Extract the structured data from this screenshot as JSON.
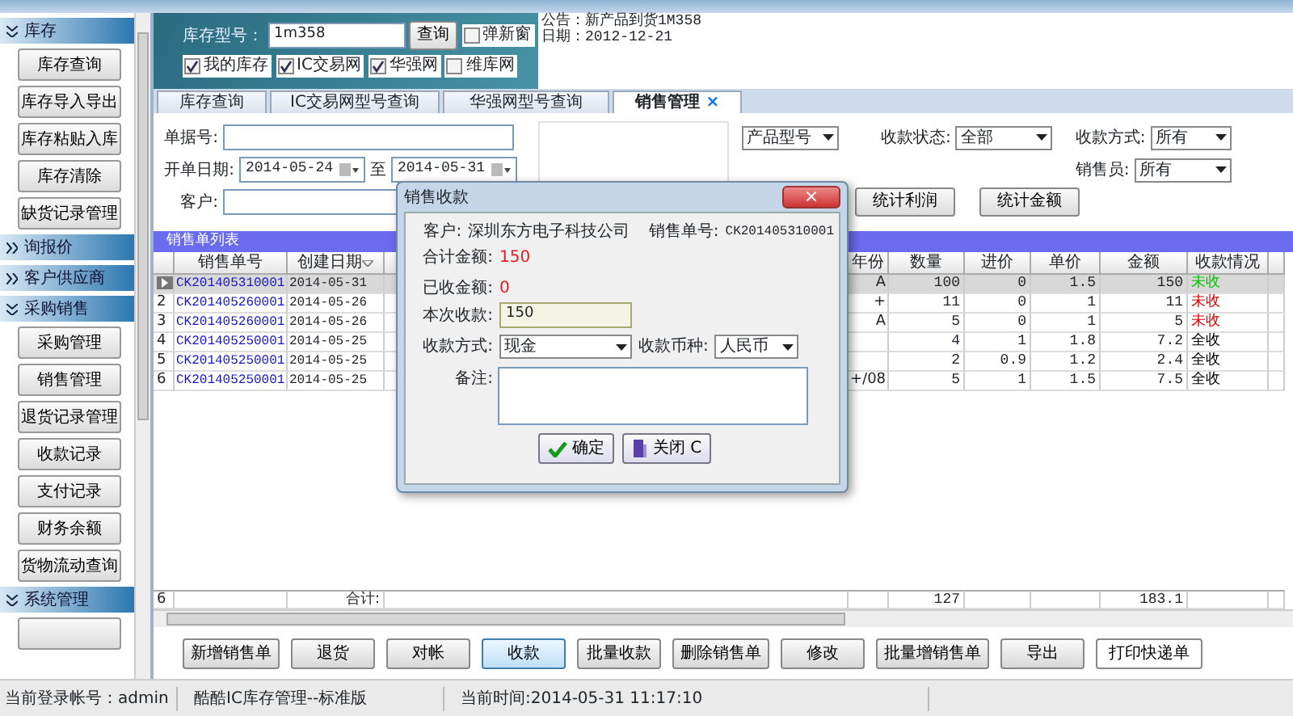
{
  "sidebar": {
    "sections": [
      {
        "label": "库存",
        "expanded": true,
        "items": [
          "库存查询",
          "库存导入导出",
          "库存粘贴入库",
          "库存清除",
          "缺货记录管理"
        ]
      },
      {
        "label": "询报价",
        "expanded": false
      },
      {
        "label": "客户供应商",
        "expanded": false
      },
      {
        "label": "采购销售",
        "expanded": true,
        "items": [
          "采购管理",
          "销售管理",
          "退货记录管理",
          "收款记录",
          "支付记录",
          "财务余额",
          "货物流动查询"
        ]
      },
      {
        "label": "系统管理",
        "expanded": true,
        "cut_off_button": true
      }
    ]
  },
  "banner": {
    "stock_label": "库存型号：",
    "stock_value": "1m358",
    "query_button": "查询",
    "new_window": {
      "label": "弹新窗",
      "checked": false
    },
    "sources": [
      {
        "label": "我的库存",
        "checked": true
      },
      {
        "label": "IC交易网",
        "checked": true
      },
      {
        "label": "华强网",
        "checked": true
      },
      {
        "label": "维库网",
        "checked": false
      }
    ],
    "notice": [
      "公告：新产品到货1M358",
      "日期：2012-12-21"
    ]
  },
  "tabs": [
    {
      "label": "库存查询",
      "selected": false
    },
    {
      "label": "IC交易网型号查询",
      "selected": false
    },
    {
      "label": "华强网型号查询",
      "selected": false
    },
    {
      "label": "销售管理",
      "selected": true,
      "close": "×"
    }
  ],
  "filters": {
    "doc_no_label": "单据号:",
    "date_label": "开单日期:",
    "date_from": "2014-05-24",
    "date_to_label": "至",
    "date_to": "2014-05-31",
    "customer_label": "客户:",
    "product_select": "产品型号",
    "pay_status_label": "收款状态:",
    "pay_status": "全部",
    "pay_method_label": "收款方式:",
    "pay_method": "所有",
    "seller_label": "销售员:",
    "seller": "所有",
    "buttons": [
      "统计利润",
      "统计金额"
    ]
  },
  "list_title": "销售单列表",
  "table": {
    "columns": [
      "销售单号",
      "创建日期",
      "年份",
      "数量",
      "进价",
      "单价",
      "金额",
      "收款情况"
    ],
    "rows": [
      {
        "selected": true,
        "cells": [
          "CK201405310001",
          "2014-05-31",
          "A",
          "100",
          "0",
          "1.5",
          "150",
          "未收"
        ],
        "color": "#00c800"
      },
      {
        "number": "2",
        "selected": false,
        "cells": [
          "CK201405260001",
          "2014-05-26",
          "+",
          "11",
          "0",
          "1",
          "11",
          "未收"
        ],
        "color": "#e00000"
      },
      {
        "number": "3",
        "selected": false,
        "cells": [
          "CK201405260001",
          "2014-05-26",
          "A",
          "5",
          "0",
          "1",
          "5",
          "未收"
        ],
        "color": "#e00000"
      },
      {
        "number": "4",
        "selected": false,
        "cells": [
          "CK201405250001",
          "2014-05-25",
          "",
          "4",
          "1",
          "1.8",
          "7.2",
          "全收"
        ],
        "color": "#000000"
      },
      {
        "number": "5",
        "selected": false,
        "cells": [
          "CK201405250001",
          "2014-05-25",
          "",
          "2",
          "0.9",
          "1.2",
          "2.4",
          "全收"
        ],
        "color": "#000000"
      },
      {
        "number": "6",
        "selected": false,
        "cells": [
          "CK201405250001",
          "2014-05-25",
          "+/08",
          "5",
          "1",
          "1.5",
          "7.5",
          "全收"
        ],
        "color": "#000000"
      }
    ],
    "summary": {
      "count": "6",
      "label": "合计:",
      "quantity": "127",
      "amount": "183.1"
    }
  },
  "actions": [
    {
      "label": "新增销售单",
      "kind": "normal"
    },
    {
      "label": "退货",
      "kind": "normal"
    },
    {
      "label": "对帐",
      "kind": "normal"
    },
    {
      "label": "收款",
      "kind": "focused"
    },
    {
      "label": "批量收款",
      "kind": "normal"
    },
    {
      "label": "删除销售单",
      "kind": "normal"
    },
    {
      "label": "修改",
      "kind": "normal"
    },
    {
      "label": "批量增销售单",
      "kind": "normal"
    },
    {
      "label": "导出",
      "kind": "normal"
    },
    {
      "label": "打印快递单",
      "kind": "flat"
    }
  ],
  "status_bar": [
    "当前登录帐号：admin",
    "酷酷IC库存管理--标准版",
    "当前时间:2014-05-31 11:17:10"
  ],
  "dialog": {
    "title": "销售收款",
    "close": "×",
    "customer_label": "客户:",
    "customer": "深圳东方电子科技公司",
    "order_label": "销售单号:",
    "order": "CK201405310001",
    "total_label": "合计金额:",
    "total": "150",
    "received_label": "已收金额:",
    "received": "0",
    "this_label": "本次收款:",
    "this_value": "150",
    "method_label": "收款方式:",
    "method": "现金",
    "currency_label": "收款币种:",
    "currency": "人民币",
    "note_label": "备注:",
    "ok": "确定",
    "cancel": "关闭 C"
  }
}
